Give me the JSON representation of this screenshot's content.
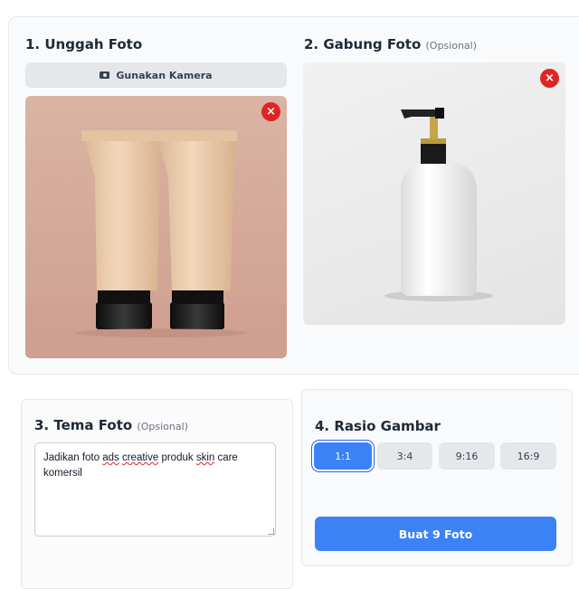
{
  "upload": {
    "title": "1. Unggah Foto",
    "camera_button": "Gunakan Kamera",
    "camera_icon": "camera-icon",
    "remove_icon": "close-icon"
  },
  "merge": {
    "title": "2. Gabung Foto",
    "optional": "(Opsional)",
    "remove_icon": "close-icon"
  },
  "theme": {
    "title": "3. Tema Foto",
    "optional": "(Opsional)",
    "text_pre": "Jadikan foto ",
    "text_ads": "ads",
    "text_space": " ",
    "text_creative": "creative",
    "text_mid": " produk ",
    "text_skin": "skin",
    "text_post": " care komersil"
  },
  "ratio": {
    "title": "4. Rasio Gambar",
    "options": [
      "1:1",
      "3:4",
      "9:16",
      "16:9"
    ],
    "selected": "1:1"
  },
  "generate_button": "Buat 9 Foto",
  "colors": {
    "accent": "#3b82f6",
    "danger": "#e02424"
  }
}
